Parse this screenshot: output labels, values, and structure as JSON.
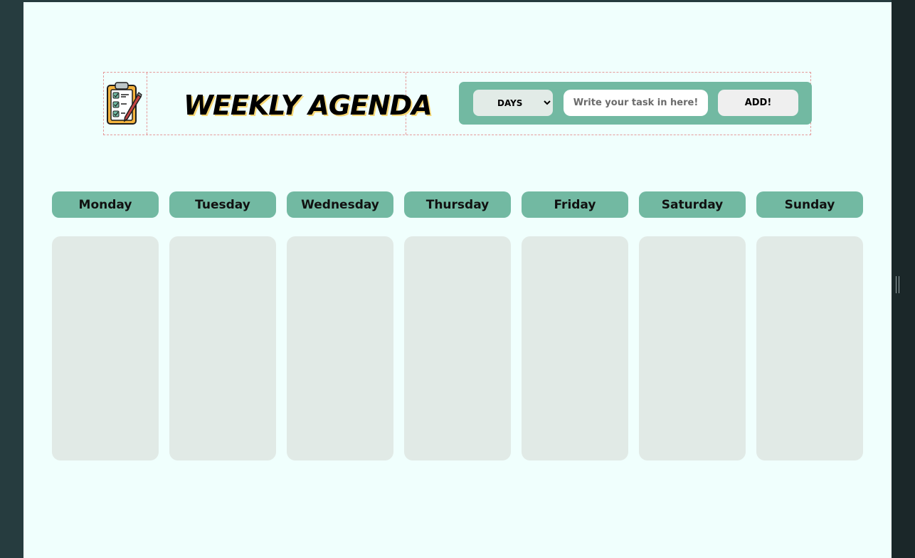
{
  "app": {
    "title": "WEEKLY AGENDA"
  },
  "form": {
    "days_select_value": "DAYS",
    "days_options": [
      "DAYS"
    ],
    "task_placeholder": "Write your task in here!",
    "task_value": "",
    "add_label": "ADD!"
  },
  "days": [
    "Monday",
    "Tuesday",
    "Wednesday",
    "Thursday",
    "Friday",
    "Saturday",
    "Sunday"
  ],
  "icons": {
    "logo": "clipboard-checklist-pencil-icon",
    "select_arrow": "chevron-down-icon",
    "resize_handle": "resize-handle-icon"
  },
  "colors": {
    "page_background": "#f0fffd",
    "accent": "#72b9a2",
    "column_fill": "#e1eae6",
    "outer_background": "#263c3f",
    "title_shadow": "#f7d774"
  }
}
